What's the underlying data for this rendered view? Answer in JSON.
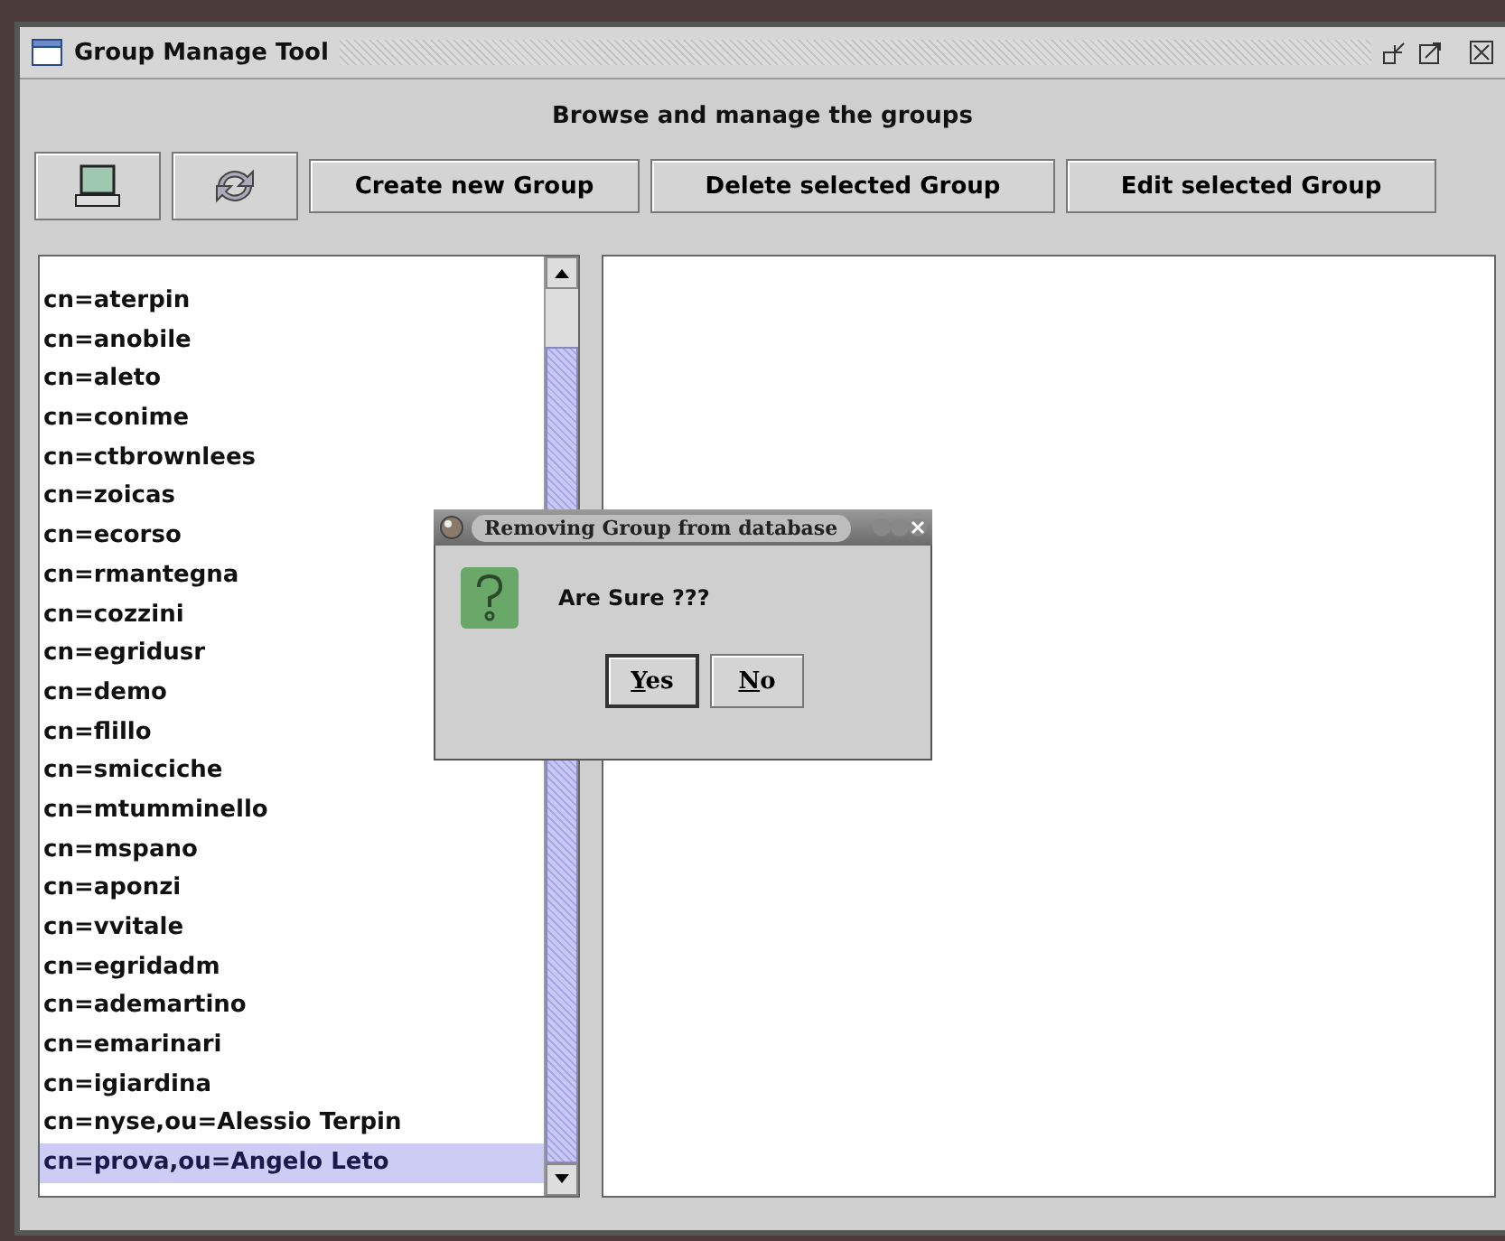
{
  "window": {
    "title": "Group Manage Tool"
  },
  "header": "Browse and manage the groups",
  "toolbar": {
    "buttons": [
      {
        "kind": "computer"
      },
      {
        "kind": "refresh"
      },
      {
        "kind": "text",
        "label": "Create new Group"
      },
      {
        "kind": "text",
        "label": "Delete selected Group"
      },
      {
        "kind": "text",
        "label": "Edit selected Group"
      }
    ]
  },
  "group_list": {
    "items": [
      {
        "label": "cn=aterpin",
        "selected": false
      },
      {
        "label": "cn=anobile",
        "selected": false
      },
      {
        "label": "cn=aleto",
        "selected": false
      },
      {
        "label": "cn=conime",
        "selected": false
      },
      {
        "label": "cn=ctbrownlees",
        "selected": false
      },
      {
        "label": "cn=zoicas",
        "selected": false
      },
      {
        "label": "cn=ecorso",
        "selected": false
      },
      {
        "label": "cn=rmantegna",
        "selected": false
      },
      {
        "label": "cn=cozzini",
        "selected": false
      },
      {
        "label": "cn=egridusr",
        "selected": false
      },
      {
        "label": "cn=demo",
        "selected": false
      },
      {
        "label": "cn=flillo",
        "selected": false
      },
      {
        "label": "cn=smicciche",
        "selected": false
      },
      {
        "label": "cn=mtumminello",
        "selected": false
      },
      {
        "label": "cn=mspano",
        "selected": false
      },
      {
        "label": "cn=aponzi",
        "selected": false
      },
      {
        "label": "cn=vvitale",
        "selected": false
      },
      {
        "label": "cn=egridadm",
        "selected": false
      },
      {
        "label": "cn=ademartino",
        "selected": false
      },
      {
        "label": "cn=emarinari",
        "selected": false
      },
      {
        "label": "cn=igiardina",
        "selected": false
      },
      {
        "label": "cn=nyse,ou=Alessio Terpin",
        "selected": false
      },
      {
        "label": "cn=prova,ou=Angelo Leto",
        "selected": true
      }
    ]
  },
  "dialog": {
    "title": "Removing Group from database",
    "message": "Are Sure ???",
    "buttons": [
      {
        "label": "Yes",
        "mnemonic_underlined": true,
        "focused": true
      },
      {
        "label": "No",
        "mnemonic_underlined": true,
        "focused": false
      }
    ]
  }
}
